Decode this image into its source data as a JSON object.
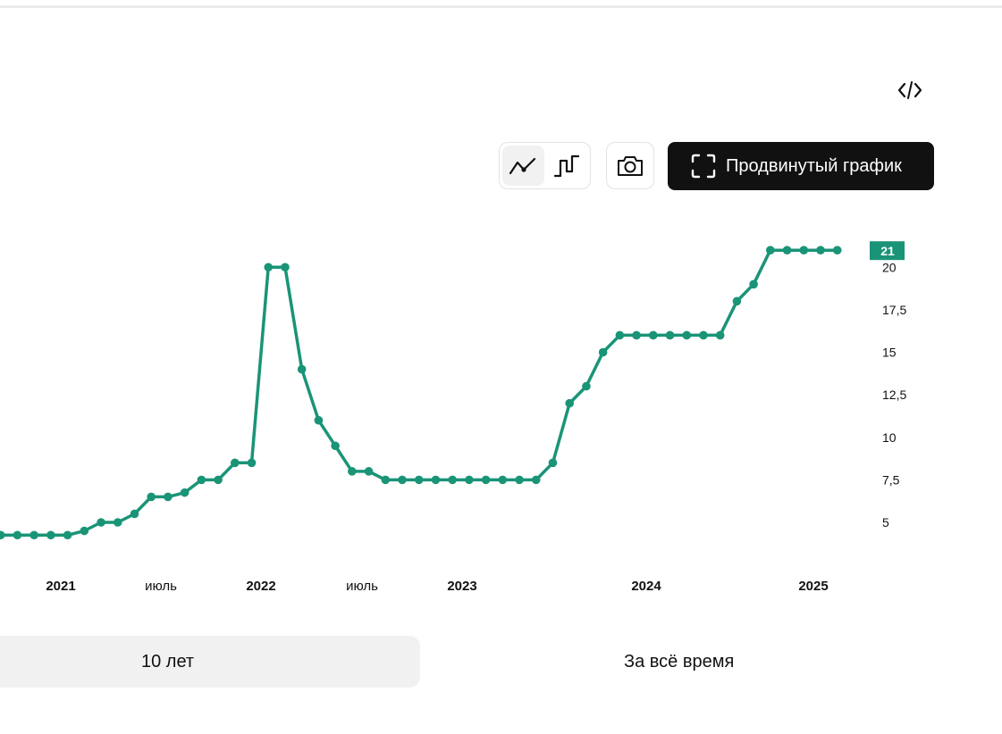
{
  "toolbar": {
    "advanced_label": "Продвинутый график",
    "chart_types": [
      "line-chart-icon",
      "step-chart-icon"
    ],
    "active_type": "line"
  },
  "periods": [
    {
      "label": "10 лет",
      "active": true
    },
    {
      "label": "За всё время",
      "active": false
    }
  ],
  "chart_data": {
    "type": "line",
    "x_ticks": [
      "2021",
      "июль",
      "2022",
      "июль",
      "2023",
      "2024",
      "2025"
    ],
    "y_ticks": [
      "5",
      "7,5",
      "10",
      "12,5",
      "15",
      "17,5",
      "20"
    ],
    "ylim": [
      3,
      22
    ],
    "last_value_label": "21",
    "color": "#1a9477",
    "series": [
      {
        "values": [
          4.25,
          4.25,
          4.25,
          4.25,
          4.25,
          4.25,
          4.5,
          5,
          5,
          5.5,
          6.5,
          6.5,
          6.75,
          7.5,
          7.5,
          8.5,
          8.5,
          20,
          20,
          14,
          11,
          9.5,
          8,
          8,
          7.5,
          7.5,
          7.5,
          7.5,
          7.5,
          7.5,
          7.5,
          7.5,
          7.5,
          7.5,
          8.5,
          12,
          13,
          15,
          16,
          16,
          16,
          16,
          16,
          16,
          16,
          18,
          19,
          21,
          21,
          21,
          21,
          21
        ]
      }
    ]
  }
}
